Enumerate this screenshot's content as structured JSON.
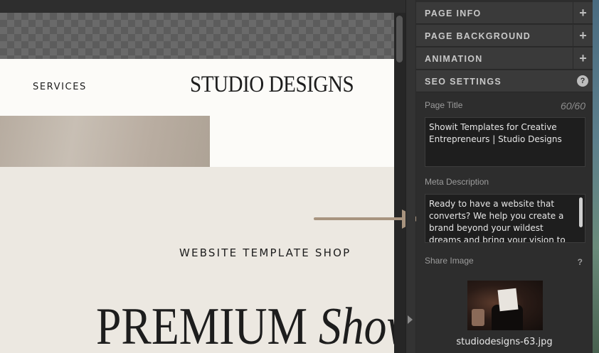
{
  "canvas": {
    "nav_item": "SERVICES",
    "brand": "STUDIO DESIGNS",
    "shop_label": "WEBSITE TEMPLATE SHOP",
    "headline_main": "PREMIUM",
    "headline_italic": "Show"
  },
  "panel": {
    "sections": [
      {
        "label": "PAGE INFO"
      },
      {
        "label": "PAGE BACKGROUND"
      },
      {
        "label": "ANIMATION"
      }
    ],
    "seo": {
      "label": "SEO SETTINGS",
      "help": "?",
      "page_title_label": "Page Title",
      "page_title_counter": "60/60",
      "page_title_value": "Showit Templates for Creative Entrepreneurs | Studio Designs",
      "meta_label": "Meta Description",
      "meta_value": "Ready to  have a website that converts? We help you create a brand beyond your wildest dreams and bring your vision to life through highly",
      "share_label": "Share Image",
      "share_help": "?",
      "share_filename": "studiodesigns-63.jpg"
    },
    "plus_glyph": "+"
  },
  "colors": {
    "arrow": "#a8947f",
    "panel_bg": "#2d2d2d",
    "section_bg": "#3a3a3a",
    "cream": "#ece8e1"
  }
}
